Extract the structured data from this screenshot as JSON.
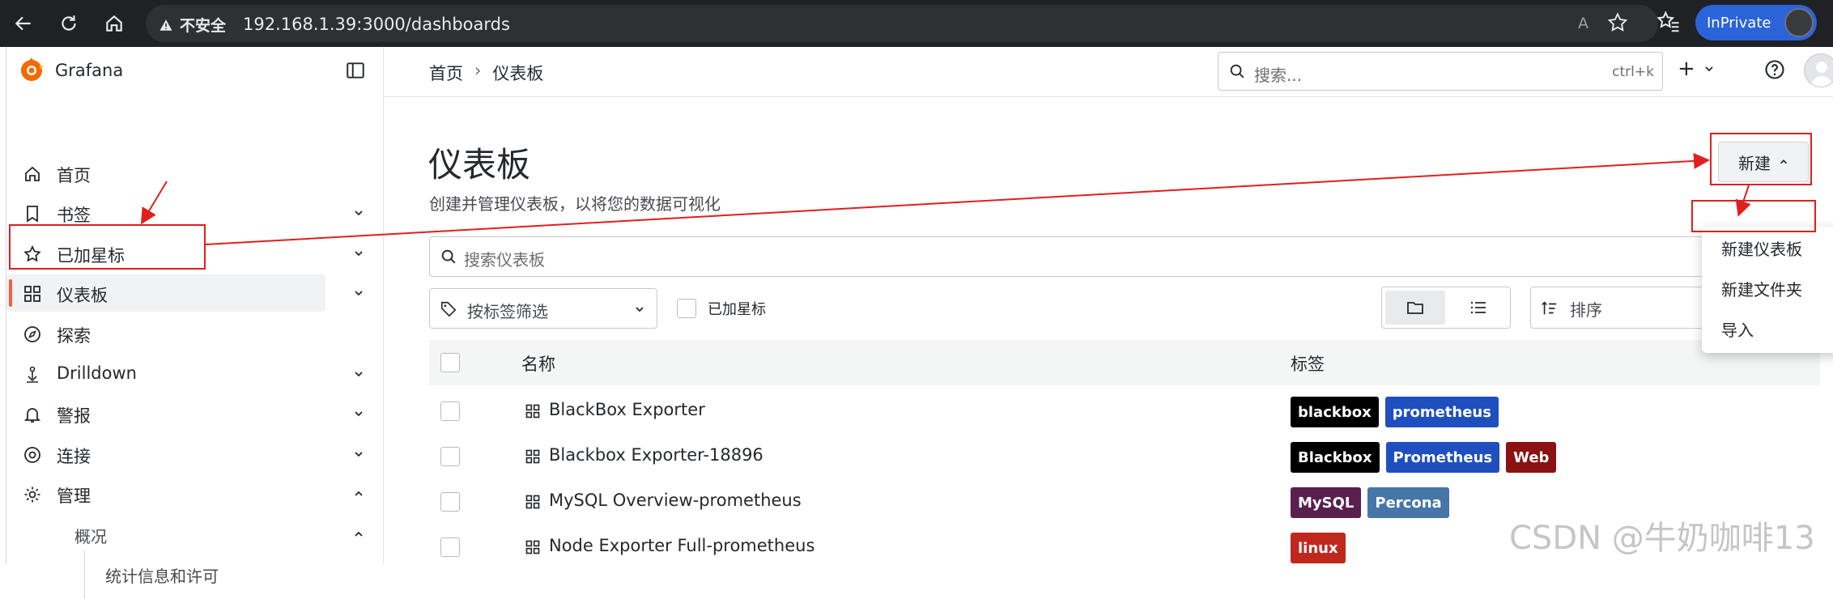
{
  "browser": {
    "security_label": "不安全",
    "url": "192.168.1.39:3000/dashboards",
    "read_aloud": "A",
    "inprivate_label": "InPrivate"
  },
  "app": {
    "name": "Grafana"
  },
  "sidebar": {
    "items": [
      {
        "label": "首页"
      },
      {
        "label": "书签"
      },
      {
        "label": "已加星标"
      },
      {
        "label": "仪表板"
      },
      {
        "label": "探索"
      },
      {
        "label": "Drilldown"
      },
      {
        "label": "警报"
      },
      {
        "label": "连接"
      },
      {
        "label": "管理"
      },
      {
        "label": "概况"
      },
      {
        "label": "统计信息和许可"
      }
    ]
  },
  "topbar": {
    "breadcrumb": [
      "首页",
      "仪表板"
    ],
    "breadcrumb_sep": "›",
    "search_placeholder": "搜索...",
    "search_shortcut": "ctrl+k",
    "plus_label": "+"
  },
  "page": {
    "title": "仪表板",
    "subtitle": "创建并管理仪表板，以将您的数据可视化",
    "new_button": "新建",
    "search_placeholder": "搜索仪表板",
    "tag_filter": "按标签筛选",
    "starred_label": "已加星标",
    "sort_label": "排序"
  },
  "new_menu": {
    "items": [
      "新建仪表板",
      "新建文件夹",
      "导入"
    ]
  },
  "table": {
    "columns": [
      "名称",
      "标签"
    ],
    "rows": [
      {
        "title": "BlackBox Exporter",
        "tags": [
          {
            "text": "blackbox",
            "color": "#000000"
          },
          {
            "text": "prometheus",
            "color": "#1f4fbf"
          }
        ]
      },
      {
        "title": "Blackbox Exporter-18896",
        "tags": [
          {
            "text": "Blackbox",
            "color": "#000000"
          },
          {
            "text": "Prometheus",
            "color": "#1f4fbf"
          },
          {
            "text": "Web",
            "color": "#8a1212"
          }
        ]
      },
      {
        "title": "MySQL Overview-prometheus",
        "tags": [
          {
            "text": "MySQL",
            "color": "#5a1f4e"
          },
          {
            "text": "Percona",
            "color": "#4676a8"
          }
        ]
      },
      {
        "title": "Node Exporter Full-prometheus",
        "tags": [
          {
            "text": "linux",
            "color": "#c0281e"
          }
        ]
      }
    ]
  },
  "watermark": "CSDN @牛奶咖啡13",
  "colors": {
    "accent": "#f55f3e",
    "annotation": "#e01f1f"
  }
}
